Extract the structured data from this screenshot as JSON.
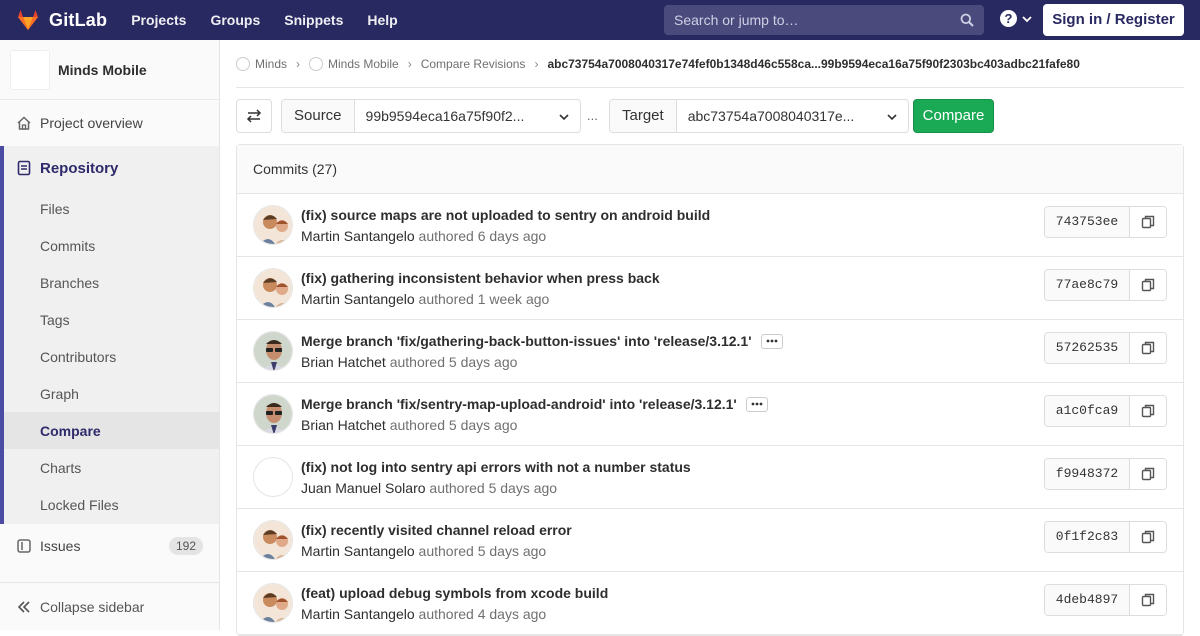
{
  "navbar": {
    "brand": "GitLab",
    "links": [
      "Projects",
      "Groups",
      "Snippets",
      "Help"
    ],
    "search_placeholder": "Search or jump to…",
    "help_glyph": "?",
    "signin_label": "Sign in / Register",
    "bg_color": "#292961"
  },
  "sidebar": {
    "project_name": "Minds Mobile",
    "overview_label": "Project overview",
    "repository_label": "Repository",
    "repo_items": [
      "Files",
      "Commits",
      "Branches",
      "Tags",
      "Contributors",
      "Graph",
      "Compare",
      "Charts",
      "Locked Files"
    ],
    "active_item": "Compare",
    "issues_label": "Issues",
    "issues_count": "192",
    "collapse_label": "Collapse sidebar"
  },
  "breadcrumb": {
    "items": [
      "Minds",
      "Minds Mobile",
      "Compare Revisions"
    ],
    "current": "abc73754a7008040317e74fef0b1348d46c558ca...99b9594eca16a75f90f2303bc403adbc21fafe80"
  },
  "compare": {
    "source_label": "Source",
    "source_value": "99b9594eca16a75f90f2...",
    "separator": "...",
    "target_label": "Target",
    "target_value": "abc73754a7008040317e...",
    "compare_label": "Compare",
    "compare_color": "#1aaa55"
  },
  "commits": {
    "header": "Commits (27)",
    "authored_word": "authored",
    "rows": [
      {
        "title": "(fix) source maps are not uploaded to sentry on android build",
        "author": "Martin Santangelo",
        "time": "6 days ago",
        "sha": "743753ee",
        "avatar": "martin",
        "more": false
      },
      {
        "title": "(fix) gathering inconsistent behavior when press back",
        "author": "Martin Santangelo",
        "time": "1 week ago",
        "sha": "77ae8c79",
        "avatar": "martin",
        "more": false
      },
      {
        "title": "Merge branch 'fix/gathering-back-button-issues' into 'release/3.12.1'",
        "author": "Brian Hatchet",
        "time": "5 days ago",
        "sha": "57262535",
        "avatar": "brian",
        "more": true
      },
      {
        "title": "Merge branch 'fix/sentry-map-upload-android' into 'release/3.12.1'",
        "author": "Brian Hatchet",
        "time": "5 days ago",
        "sha": "a1c0fca9",
        "avatar": "brian",
        "more": true
      },
      {
        "title": "(fix) not log into sentry api errors with not a number status",
        "author": "Juan Manuel Solaro",
        "time": "5 days ago",
        "sha": "f9948372",
        "avatar": "blank",
        "more": false
      },
      {
        "title": "(fix) recently visited channel reload error",
        "author": "Martin Santangelo",
        "time": "5 days ago",
        "sha": "0f1f2c83",
        "avatar": "martin",
        "more": false
      },
      {
        "title": "(feat) upload debug symbols from xcode build",
        "author": "Martin Santangelo",
        "time": "4 days ago",
        "sha": "4deb4897",
        "avatar": "martin",
        "more": false
      }
    ]
  }
}
